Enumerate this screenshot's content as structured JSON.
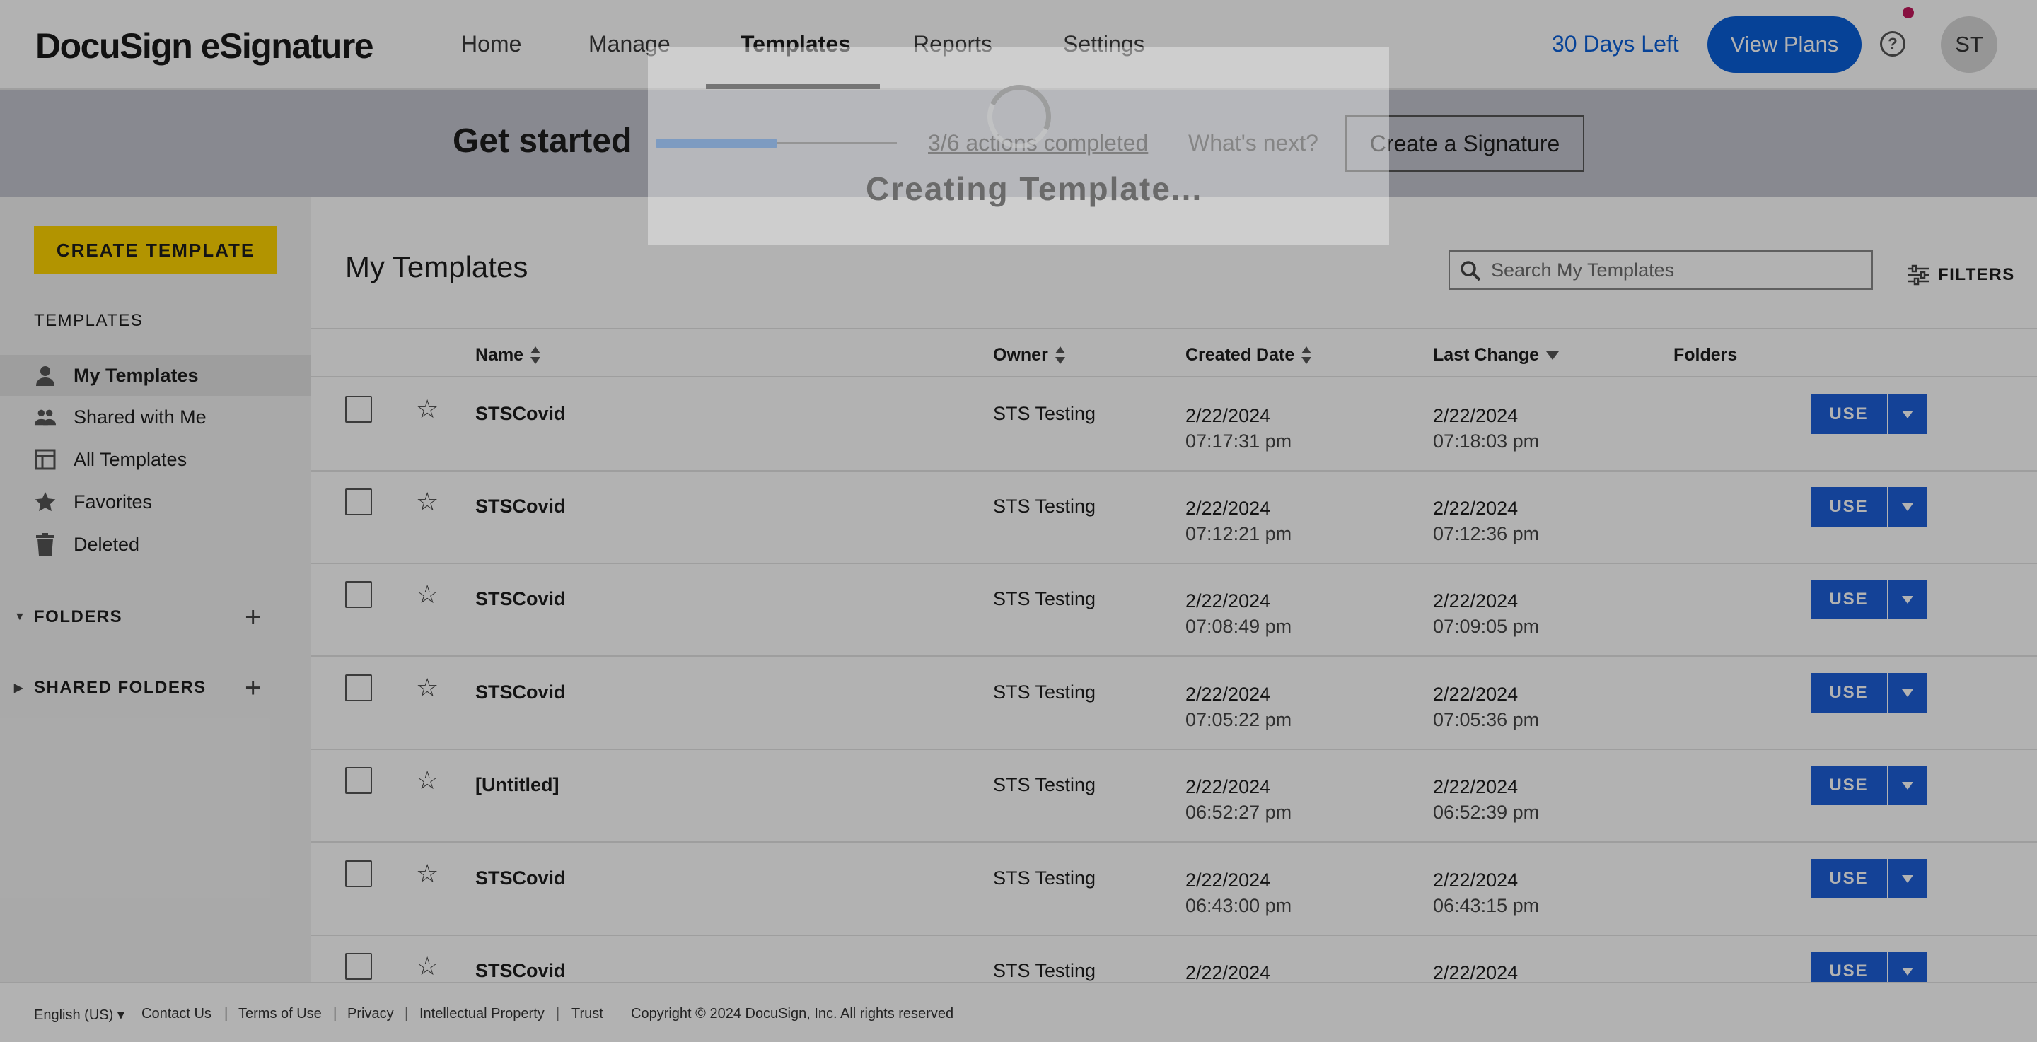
{
  "topnav": {
    "logo": "DocuSign eSignature",
    "items": [
      {
        "label": "Home"
      },
      {
        "label": "Manage"
      },
      {
        "label": "Templates"
      },
      {
        "label": "Reports"
      },
      {
        "label": "Settings"
      }
    ],
    "active": "Templates",
    "days_left": "30 Days Left",
    "view_plans": "View Plans",
    "help_icon": "help-circle-icon",
    "avatar_initials": "ST"
  },
  "banner": {
    "title": "Get started",
    "progress": 0.5,
    "actions_text": "3/6 actions completed",
    "whats_next": "What's next?",
    "cta": "Create a Signature"
  },
  "sidebar": {
    "create_button": "CREATE TEMPLATE",
    "heading": "TEMPLATES",
    "items": [
      {
        "label": "My Templates",
        "icon": "person-icon",
        "active": true
      },
      {
        "label": "Shared with Me",
        "icon": "people-icon",
        "active": false
      },
      {
        "label": "All Templates",
        "icon": "layout-icon",
        "active": false
      },
      {
        "label": "Favorites",
        "icon": "star-icon",
        "active": false
      },
      {
        "label": "Deleted",
        "icon": "trash-icon",
        "active": false
      }
    ],
    "folders": "FOLDERS",
    "shared_folders": "SHARED FOLDERS"
  },
  "main": {
    "title": "My Templates",
    "search_placeholder": "Search My Templates",
    "filters": "FILTERS",
    "columns": {
      "name": "Name",
      "owner": "Owner",
      "created": "Created Date",
      "last_change": "Last Change",
      "folders": "Folders"
    },
    "use_label": "USE",
    "rows": [
      {
        "name": "STSCovid",
        "owner": "STS Testing",
        "created_date": "2/22/2024",
        "created_time": "07:17:31 pm",
        "last_date": "2/22/2024",
        "last_time": "07:18:03 pm"
      },
      {
        "name": "STSCovid",
        "owner": "STS Testing",
        "created_date": "2/22/2024",
        "created_time": "07:12:21 pm",
        "last_date": "2/22/2024",
        "last_time": "07:12:36 pm"
      },
      {
        "name": "STSCovid",
        "owner": "STS Testing",
        "created_date": "2/22/2024",
        "created_time": "07:08:49 pm",
        "last_date": "2/22/2024",
        "last_time": "07:09:05 pm"
      },
      {
        "name": "STSCovid",
        "owner": "STS Testing",
        "created_date": "2/22/2024",
        "created_time": "07:05:22 pm",
        "last_date": "2/22/2024",
        "last_time": "07:05:36 pm"
      },
      {
        "name": "[Untitled]",
        "owner": "STS Testing",
        "created_date": "2/22/2024",
        "created_time": "06:52:27 pm",
        "last_date": "2/22/2024",
        "last_time": "06:52:39 pm"
      },
      {
        "name": "STSCovid",
        "owner": "STS Testing",
        "created_date": "2/22/2024",
        "created_time": "06:43:00 pm",
        "last_date": "2/22/2024",
        "last_time": "06:43:15 pm"
      },
      {
        "name": "STSCovid",
        "owner": "STS Testing",
        "created_date": "2/22/2024",
        "created_time": "",
        "last_date": "2/22/2024",
        "last_time": ""
      }
    ]
  },
  "footer": {
    "language": "English (US)",
    "links": [
      "Contact Us",
      "Terms of Use",
      "Privacy",
      "Intellectual Property",
      "Trust"
    ],
    "copyright": "Copyright © 2024 DocuSign, Inc. All rights reserved"
  },
  "modal": {
    "text": "Creating Template..."
  },
  "colors": {
    "brand_blue": "#0a5fd8",
    "use_blue": "#1e5fd8",
    "create_yellow": "#ffd400",
    "progress_blue": "#2f7be0"
  }
}
